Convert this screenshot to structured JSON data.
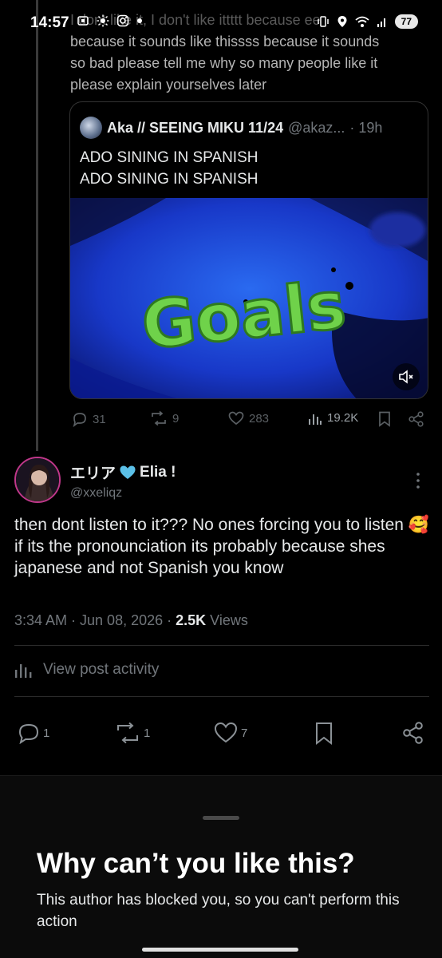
{
  "status_bar": {
    "time": "14:57",
    "battery": "77",
    "left_icons": [
      "screen-record-icon",
      "brightness-icon",
      "instagram-icon",
      "dot-icon"
    ],
    "right_icons": [
      "vibrate-icon",
      "location-icon",
      "wifi-icon",
      "signal-icon"
    ]
  },
  "parent_post": {
    "text_top_faded": "I dont like it, I don't like ittttt because ee",
    "text_lines": [
      "because it sounds like thissss because it sounds",
      "so bad please tell me why so many people like it",
      "please explain yourselves later"
    ],
    "quote": {
      "name": "Aka // SEEING MIKU 11/24",
      "handle": "@akaz...",
      "time": "· 19h",
      "text_lines": [
        "ADO SINING IN SPANISH",
        "ADO SINING IN SPANISH"
      ],
      "media_caption": "Goals"
    },
    "actions": {
      "replies": "31",
      "reposts": "9",
      "likes": "283",
      "views": "19.2K"
    }
  },
  "reply": {
    "display_name": "エリア",
    "display_name_suffix": "Elia !",
    "handle": "@xxeliqz",
    "text": "then dont listen to it??? No ones forcing you to listen 🥰 if its the pronounciation its probably because shes japanese and not Spanish you know",
    "timestamp": "3:34 AM · Jun 08, 2026 · ",
    "views_count": "2.5K",
    "views_label": " Views",
    "view_activity": "View post activity",
    "actions": {
      "replies": "1",
      "reposts": "1",
      "likes": "7"
    }
  },
  "sheet": {
    "title": "Why can’t you like this?",
    "body": "This author has blocked you, so you can't perform this action"
  },
  "colors": {
    "background": "#000000",
    "text": "#e7e9ea",
    "muted": "#71767b",
    "heart_emoji": "#5bc0e8"
  }
}
